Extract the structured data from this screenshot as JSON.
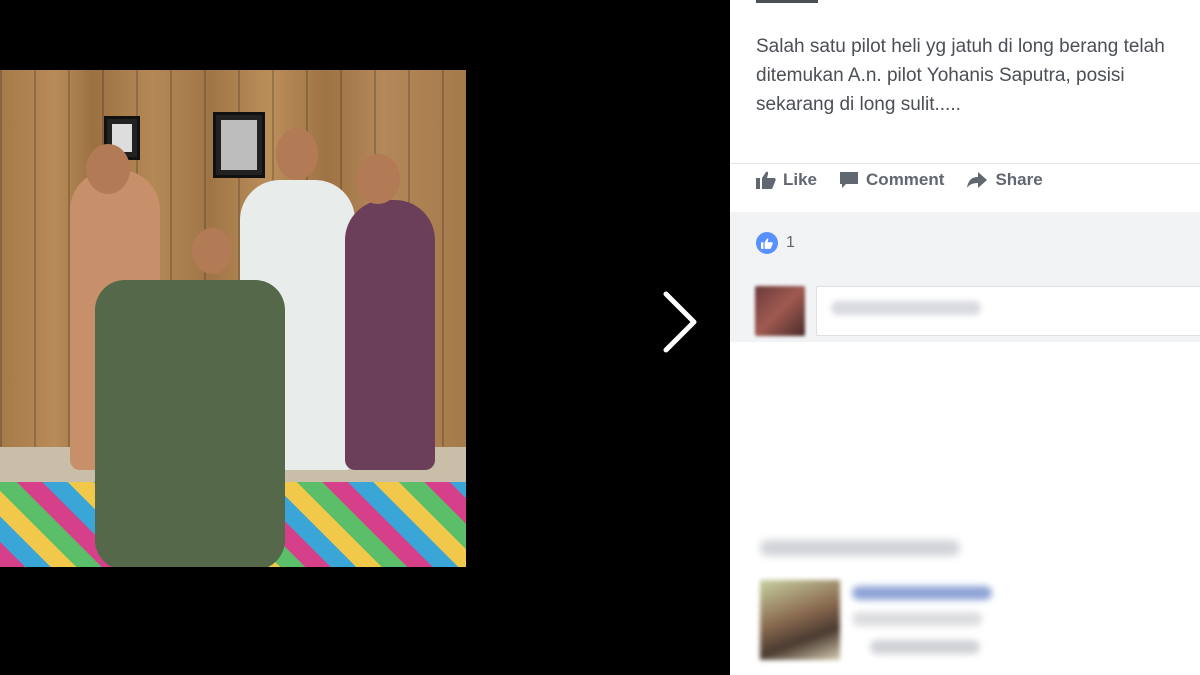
{
  "viewer": {
    "next_icon": "chevron-right-icon",
    "photo_alt": ""
  },
  "post": {
    "text": "Salah satu pilot heli yg jatuh di long berang telah\nditemukan A.n. pilot Yohanis Saputra, posisi\nsekarang di long sulit.....",
    "actions": [
      {
        "label": "Like",
        "icon": "thumbs-up-icon"
      },
      {
        "label": "Comment",
        "icon": "comment-icon"
      },
      {
        "label": "Share",
        "icon": "share-arrow-icon"
      }
    ],
    "reaction_count": "1",
    "reaction_icon": "like-reaction-icon"
  },
  "colors": {
    "text": "#4b4f56",
    "action_text": "#606770",
    "like_blue": "#5890ff",
    "panel_bg": "#ffffff",
    "reactions_bg": "#f2f3f5"
  }
}
